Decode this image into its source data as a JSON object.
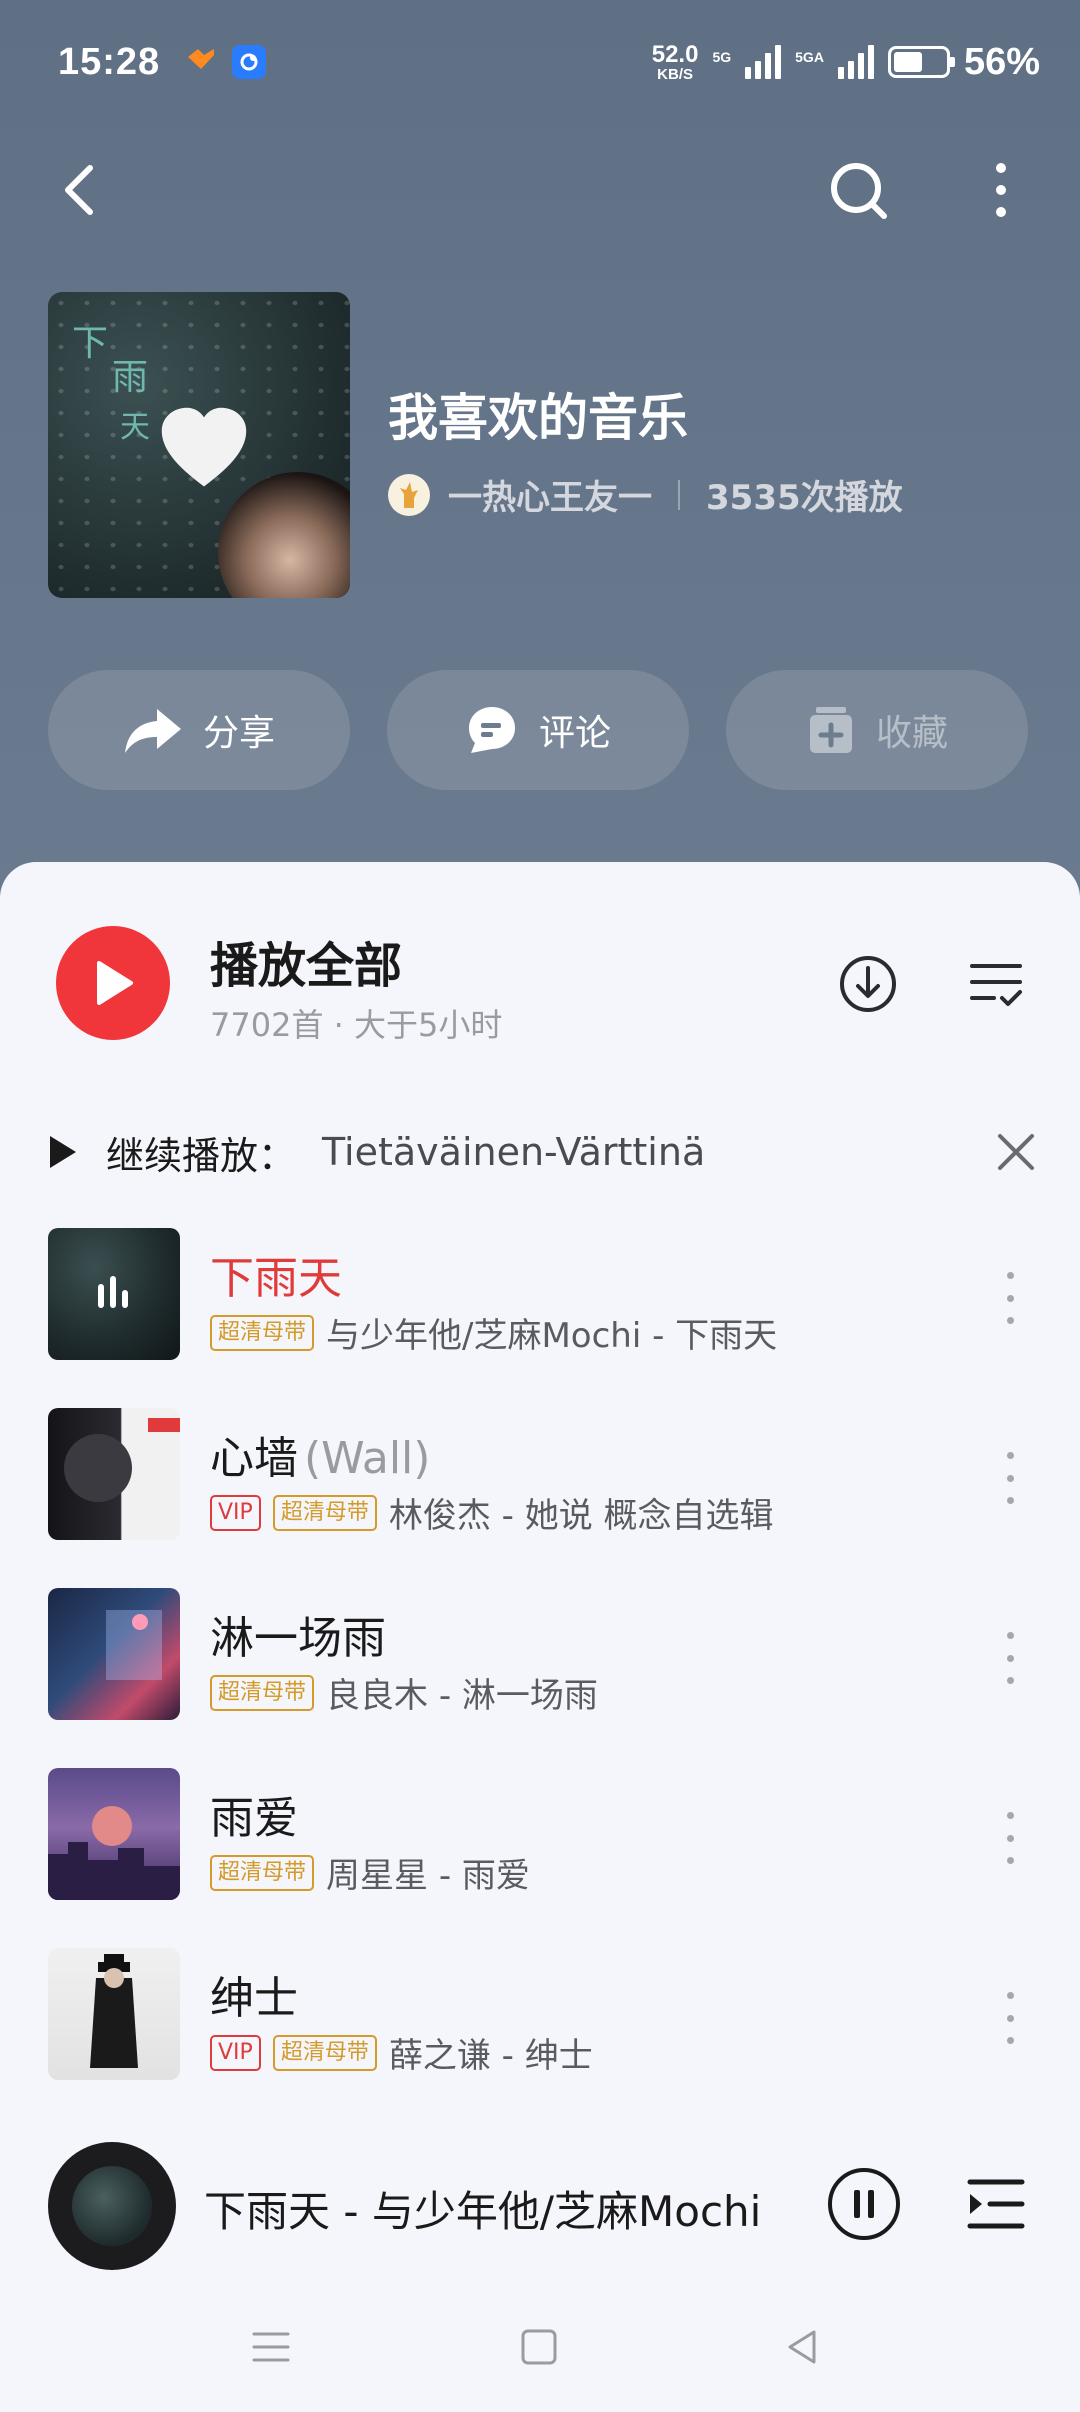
{
  "status_bar": {
    "time": "15:28",
    "speed_value": "52.0",
    "speed_unit": "KB/S",
    "net1": "5G",
    "net2": "5GA",
    "battery_pct": "56%",
    "battery_level": 0.56
  },
  "header": {
    "back_icon": "back-arrow-icon",
    "search_icon": "search-icon",
    "more_icon": "more-vertical-icon"
  },
  "playlist": {
    "title": "我喜欢的音乐",
    "owner": "一热心王友一",
    "play_count": "3535次播放",
    "cover_text": [
      "下",
      "雨",
      "天"
    ]
  },
  "actions": [
    {
      "label": "分享",
      "icon": "share-icon"
    },
    {
      "label": "评论",
      "icon": "comment-icon"
    },
    {
      "label": "收藏",
      "icon": "add-collection-icon"
    }
  ],
  "play_all": {
    "title": "播放全部",
    "subtitle": "7702首 · 大于5小时"
  },
  "resume": {
    "label": "继续播放：",
    "track": "Tietäväinen-Värttinä"
  },
  "songs": [
    {
      "title": "下雨天",
      "subtitle": "",
      "badges": [
        "超清母带"
      ],
      "info": "与少年他/芝麻Mochi - 下雨天",
      "playing": true
    },
    {
      "title": "心墙",
      "subtitle": "(Wall)",
      "badges": [
        "VIP",
        "超清母带"
      ],
      "info": "林俊杰 - 她说 概念自选辑",
      "playing": false
    },
    {
      "title": "淋一场雨",
      "subtitle": "",
      "badges": [
        "超清母带"
      ],
      "info": "良良木 - 淋一场雨",
      "playing": false
    },
    {
      "title": "雨爱",
      "subtitle": "",
      "badges": [
        "超清母带"
      ],
      "info": "周星星 - 雨爱",
      "playing": false
    },
    {
      "title": "绅士",
      "subtitle": "",
      "badges": [
        "VIP",
        "超清母带"
      ],
      "info": "薛之谦 - 绅士",
      "playing": false
    }
  ],
  "mini_player": {
    "text": "下雨天 - 与少年他/芝麻Mochi"
  },
  "colors": {
    "accent": "#f0363a",
    "header_bg": "#66768b",
    "playing_title": "#e13a3a",
    "vip": "#e13a3a",
    "hq": "#d49a2a"
  }
}
